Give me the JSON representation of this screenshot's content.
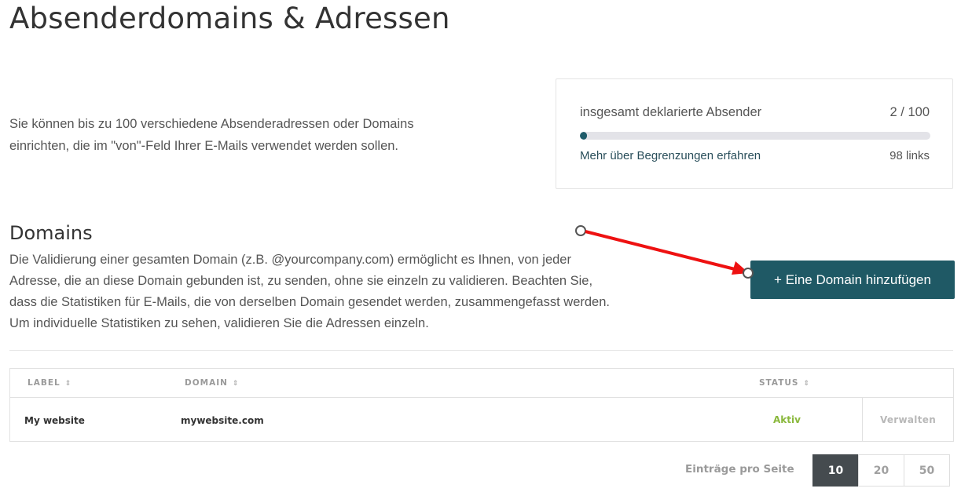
{
  "page": {
    "title": "Absenderdomains & Adressen",
    "intro": "Sie können bis zu 100 verschiedene Absenderadressen oder Domains einrichten, die im \"von\"-Feld Ihrer E-Mails verwendet werden sollen."
  },
  "quota": {
    "label": "insgesamt deklarierte Absender",
    "count": "2 / 100",
    "used_fraction": 0.02,
    "link": "Mehr über Begrenzungen erfahren",
    "remaining": "98 links"
  },
  "domains": {
    "title": "Domains",
    "description": "Die Validierung einer gesamten Domain (z.B. @yourcompany.com) ermöglicht es Ihnen, von jeder Adresse, die an diese Domain gebunden ist, zu senden, ohne sie einzeln zu validieren. Beachten Sie, dass die Statistiken für E-Mails, die von derselben Domain gesendet werden, zusammengefasst werden. Um individuelle Statistiken zu sehen, validieren Sie die Adressen einzeln.",
    "add_button": "+ Eine Domain hinzufügen",
    "table": {
      "columns": {
        "label": "LABEL",
        "domain": "DOMAIN",
        "status": "STATUS"
      },
      "sort_icon": "sort-updown-icon",
      "rows": [
        {
          "label": "My website",
          "domain": "mywebsite.com",
          "status": "Aktiv",
          "action": "Verwalten"
        }
      ]
    },
    "pagination": {
      "label": "Einträge pro Seite",
      "options": [
        "10",
        "20",
        "50"
      ],
      "selected": "10"
    }
  },
  "colors": {
    "accent": "#1f5965",
    "status_active": "#8ab83c",
    "annotation_arrow": "#ee1111"
  }
}
